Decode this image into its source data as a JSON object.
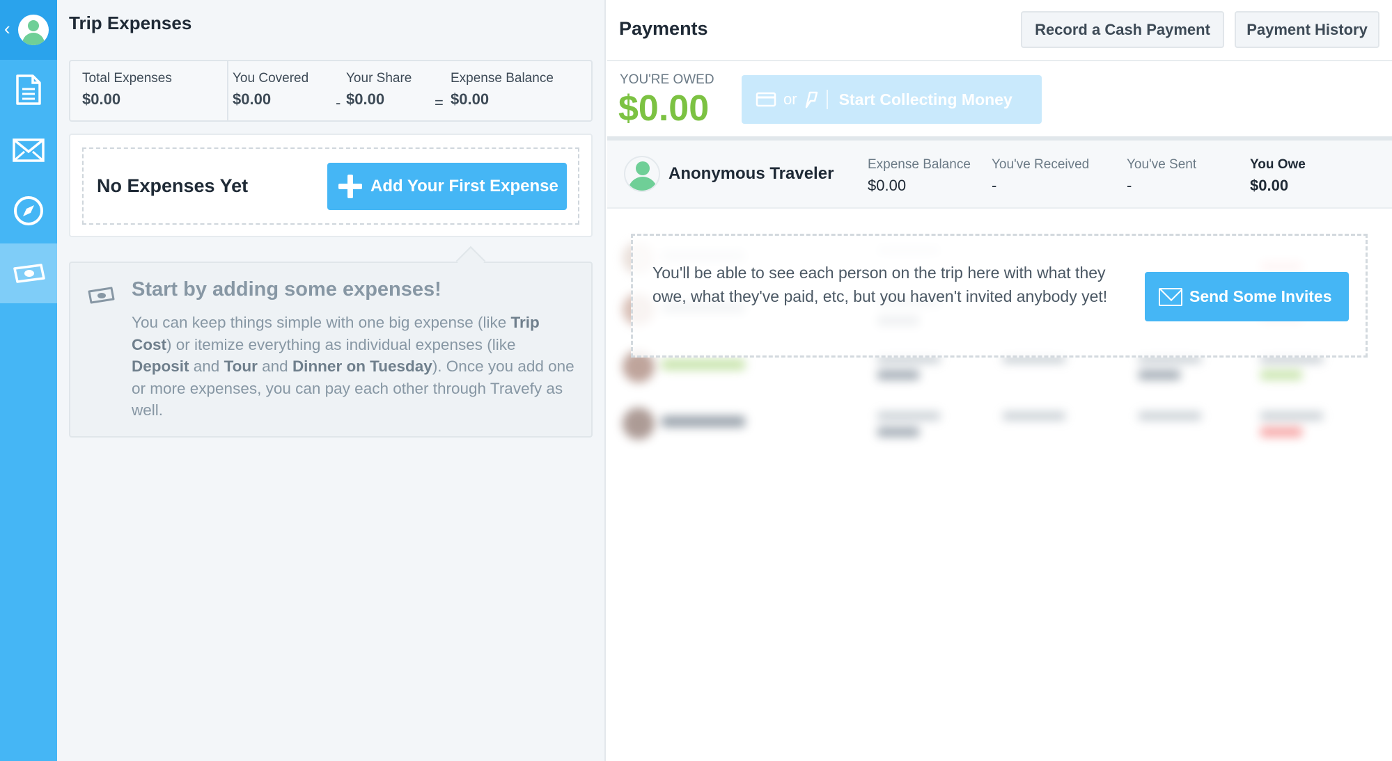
{
  "colors": {
    "sidebar": "#45b6f5",
    "accent": "#45b6f5",
    "owed_green": "#7cc242"
  },
  "sidebar": {
    "items": [
      {
        "icon": "document-icon"
      },
      {
        "icon": "mail-icon"
      },
      {
        "icon": "compass-icon"
      },
      {
        "icon": "money-icon",
        "active": true
      }
    ]
  },
  "expenses": {
    "title": "Trip Expenses",
    "summary": {
      "total_label": "Total Expenses",
      "total_value": "$0.00",
      "covered_label": "You Covered",
      "covered_value": "$0.00",
      "minus": "-",
      "share_label": "Your Share",
      "share_value": "$0.00",
      "equals": "=",
      "balance_label": "Expense Balance",
      "balance_value": "$0.00"
    },
    "empty_label": "No Expenses Yet",
    "add_button": "Add Your First Expense",
    "tip": {
      "title": "Start by adding some expenses!",
      "p1": "You can keep things simple with one big expense (like ",
      "b1": "Trip Cost",
      "p2": ") or itemize everything as individual expenses (like ",
      "b2": "Deposit",
      "p3": " and ",
      "b3": "Tour",
      "p4": " and ",
      "b4": "Dinner on Tuesday",
      "p5": "). Once you add one or more expenses, you can pay each other through Travefy as well."
    }
  },
  "payments": {
    "title": "Payments",
    "record_button": "Record a Cash Payment",
    "history_button": "Payment History",
    "owed_label": "YOU'RE OWED",
    "owed_amount": "$0.00",
    "collect_or": "or",
    "collect_label": "Start Collecting Money",
    "me": {
      "name": "Anonymous Traveler",
      "balance_label": "Expense Balance",
      "balance_value": "$0.00",
      "received_label": "You've Received",
      "received_value": "-",
      "sent_label": "You've Sent",
      "sent_value": "-",
      "owe_label": "You Owe",
      "owe_value": "$0.00"
    },
    "invite_text": "You'll be able to see each person on the trip here with what they owe, what they've paid, etc, but you haven't invited anybody yet!",
    "invite_button": "Send Some Invites"
  }
}
